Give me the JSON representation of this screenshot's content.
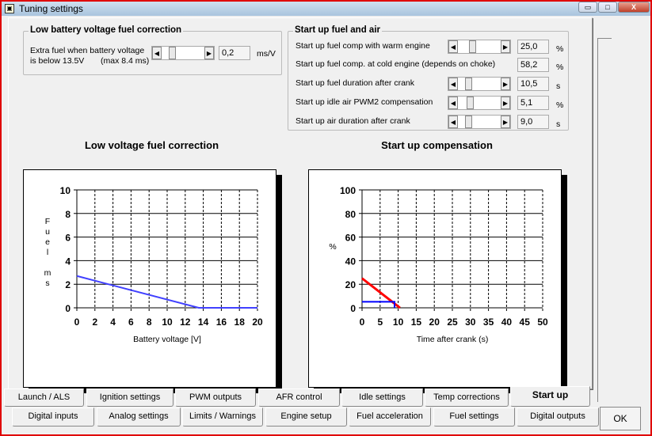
{
  "window": {
    "title": "Tuning settings",
    "minimize": "▭",
    "maximize": "□",
    "close": "X"
  },
  "low_battery": {
    "title": "Low battery voltage fuel correction",
    "label_line1": "Extra fuel when battery voltage",
    "label_line2": "is below 13.5V",
    "max_note": "(max 8.4 ms)",
    "value": "0,2",
    "unit": "ms/V",
    "slider_level": 0.2
  },
  "startup": {
    "title": "Start up fuel and air",
    "rows": [
      {
        "label": "Start up fuel comp with warm engine",
        "value": "25,0",
        "unit": "%",
        "slider_level": 0.3,
        "has_slider": true
      },
      {
        "label": "Start up fuel comp. at cold engine (depends on choke)",
        "value": "58,2",
        "unit": "%",
        "has_slider": false
      },
      {
        "label": "Start up fuel duration after crank",
        "value": "10,5",
        "unit": "s",
        "slider_level": 0.2,
        "has_slider": true
      },
      {
        "label": "Start up idle air PWM2 compensation",
        "value": "5,1",
        "unit": "%",
        "slider_level": 0.25,
        "has_slider": true
      },
      {
        "label": "Start up air duration after crank",
        "value": "9,0",
        "unit": "s",
        "slider_level": 0.2,
        "has_slider": true
      }
    ]
  },
  "chart_data": [
    {
      "type": "line",
      "title": "Low voltage fuel correction",
      "xlabel": "Battery voltage [V]",
      "ylabel": "Fuel ms",
      "xlim": [
        0,
        20
      ],
      "ylim": [
        0,
        10
      ],
      "xticks": [
        "0",
        "2",
        "4",
        "6",
        "8",
        "10",
        "12",
        "14",
        "16",
        "18",
        "20"
      ],
      "yticks": [
        "0",
        "2",
        "4",
        "6",
        "8",
        "10"
      ],
      "grid": true,
      "series": [
        {
          "color": "#4040ff",
          "x": [
            0,
            13.5,
            20
          ],
          "y": [
            2.7,
            0,
            0
          ]
        }
      ]
    },
    {
      "type": "line",
      "title": "Start up compensation",
      "xlabel": "Time after crank (s)",
      "ylabel": "%",
      "xlim": [
        0,
        50
      ],
      "ylim": [
        0,
        100
      ],
      "xticks": [
        "0",
        "5",
        "10",
        "15",
        "20",
        "25",
        "30",
        "35",
        "40",
        "45",
        "50"
      ],
      "yticks": [
        "0",
        "20",
        "40",
        "60",
        "80",
        "100"
      ],
      "grid": true,
      "series": [
        {
          "color": "#ff0000",
          "x": [
            0,
            10.5
          ],
          "y": [
            25,
            0
          ]
        },
        {
          "color": "#0000ff",
          "x": [
            0,
            9,
            9
          ],
          "y": [
            5.1,
            5.1,
            0
          ]
        }
      ]
    }
  ],
  "tabs_row1": [
    "Launch / ALS",
    "Ignition settings",
    "PWM outputs",
    "AFR control",
    "Idle settings",
    "Temp corrections",
    "Start up"
  ],
  "tabs_row2": [
    "Digital inputs",
    "Analog settings",
    "Limits / Warnings",
    "Engine setup",
    "Fuel acceleration",
    "Fuel settings",
    "Digital outputs"
  ],
  "selected_tab": "Start up",
  "ok_label": "OK"
}
